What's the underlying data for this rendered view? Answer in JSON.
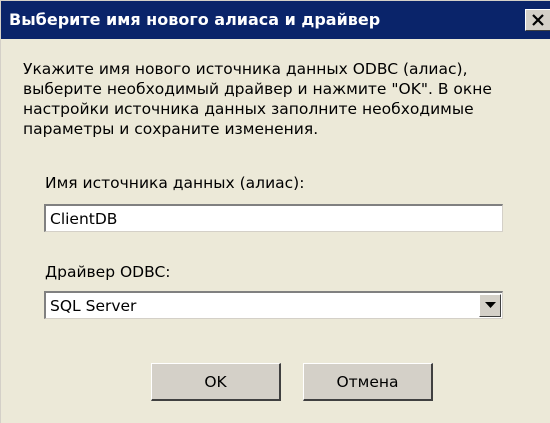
{
  "window": {
    "title": "Выберите имя нового алиаса и драйвер",
    "close_icon": "close-icon"
  },
  "description": "Укажите имя нового источника данных ODBC (алиас),\nвыберите необходимый драйвер и нажмите \"OK\". В окне\nнастройки источника данных заполните необходимые\nпараметры и сохраните изменения.",
  "alias": {
    "label": "Имя источника данных (алиас):",
    "value": "ClientDB"
  },
  "driver": {
    "label": "Драйвер ODBC:",
    "selected": "SQL Server",
    "arrow_icon": "chevron-down-icon"
  },
  "buttons": {
    "ok_label": "OK",
    "cancel_label": "Отмена"
  },
  "colors": {
    "title_bar": "#0a246a",
    "dialog_bg": "#ece9d8",
    "button_face": "#d4d0c8"
  }
}
